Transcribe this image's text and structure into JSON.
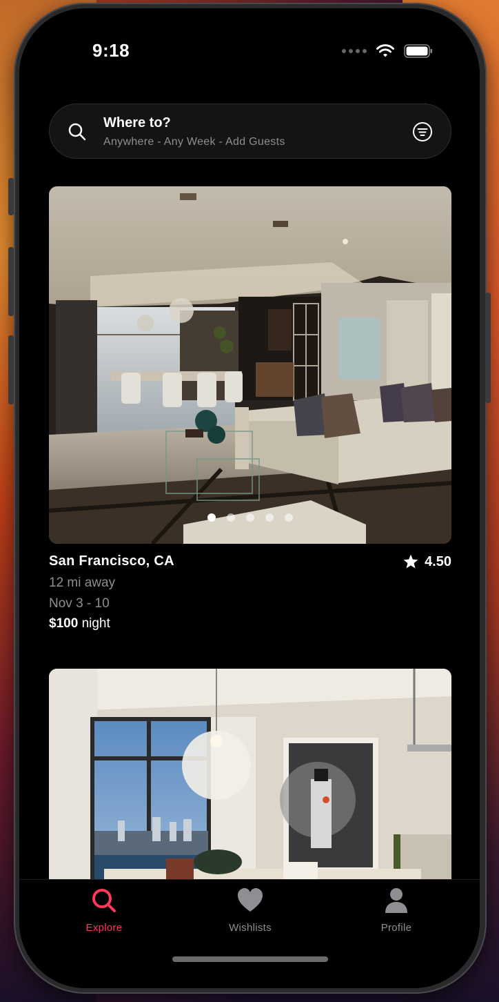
{
  "status_bar": {
    "time": "9:18"
  },
  "search": {
    "title": "Where to?",
    "subtitle": "Anywhere - Any Week - Add Guests"
  },
  "listings": [
    {
      "location": "San Francisco, CA",
      "rating": "4.50",
      "distance": "12 mi away",
      "dates": "Nov 3 - 10",
      "price": "$100",
      "price_unit": "night",
      "image_count": 5,
      "active_image": 1
    }
  ],
  "tabs": [
    {
      "label": "Explore",
      "icon": "search-icon",
      "active": true
    },
    {
      "label": "Wishlists",
      "icon": "heart-icon",
      "active": false
    },
    {
      "label": "Profile",
      "icon": "person-icon",
      "active": false
    }
  ],
  "colors": {
    "accent": "#ff385c",
    "inactive": "#8e8e93",
    "background": "#000000"
  }
}
